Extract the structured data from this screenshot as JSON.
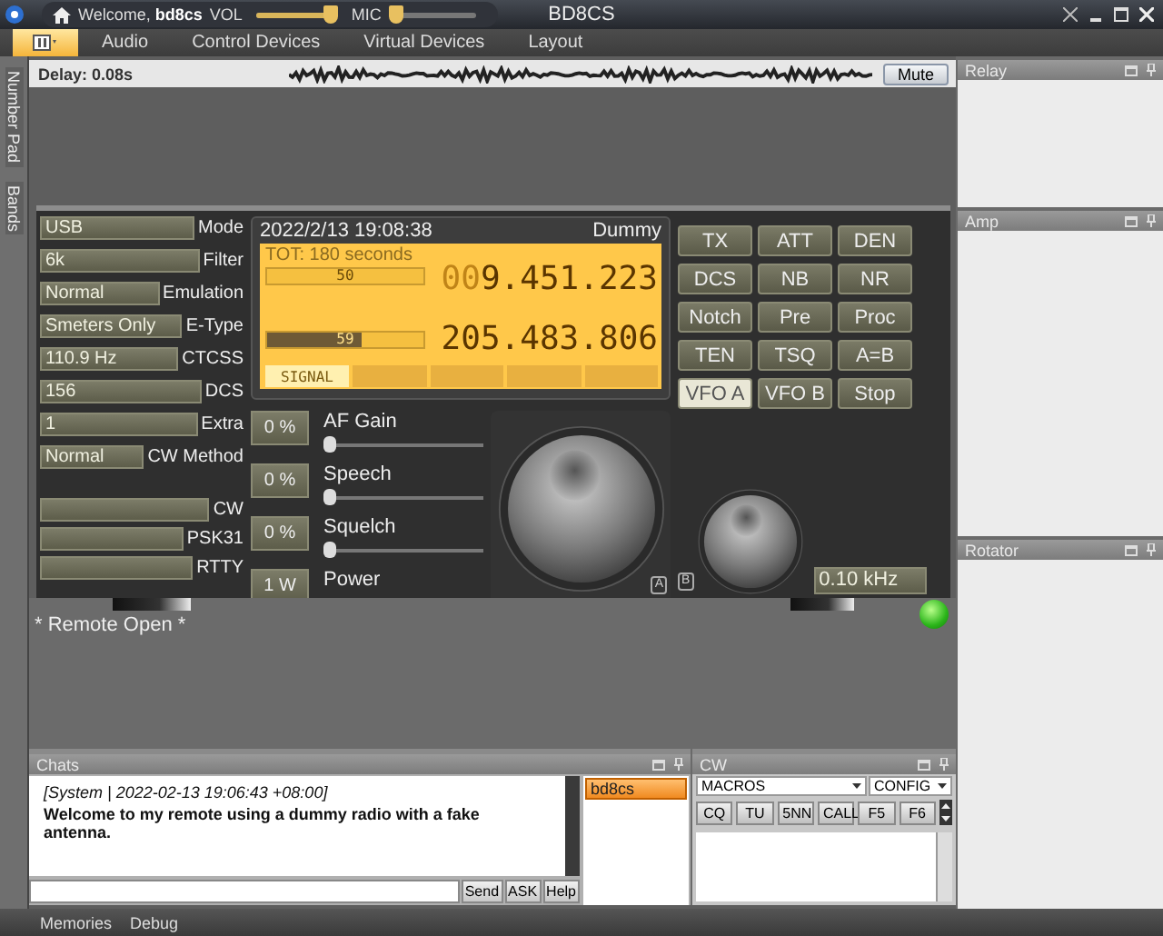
{
  "title_bar": {
    "welcome": "Welcome, **bd8cs**",
    "sliders": [
      {
        "label": "VOL",
        "level": 0.92
      },
      {
        "label": "MIC",
        "level": 0.0
      }
    ]
  },
  "window": {
    "title": "BD8CS"
  },
  "menu": [
    {
      "kind": "icon",
      "selected": true
    },
    {
      "kind": "text",
      "label": "Audio",
      "selected": false
    },
    {
      "kind": "text",
      "label": "Control Devices",
      "selected": false
    },
    {
      "kind": "text",
      "label": "Virtual Devices",
      "selected": false
    },
    {
      "kind": "text",
      "label": "Layout",
      "selected": false
    }
  ],
  "side_tabs": [
    "Number Pad",
    "Bands"
  ],
  "audio_bar": {
    "delay": "Delay: 0.08s",
    "mute": "Mute"
  },
  "radio": {
    "settings": [
      {
        "value": "USB",
        "label": "Mode"
      },
      {
        "value": "6k",
        "label": "Filter"
      },
      {
        "value": "Normal",
        "label": "Emulation"
      },
      {
        "value": "Smeters Only",
        "label": "E-Type"
      },
      {
        "value": "110.9 Hz",
        "label": "CTCSS"
      },
      {
        "value": "156",
        "label": "DCS"
      },
      {
        "value": "1",
        "label": "Extra"
      },
      {
        "value": "Normal",
        "label": "CW Method"
      }
    ],
    "modes": [
      {
        "label": "CW"
      },
      {
        "label": "PSK31"
      },
      {
        "label": "RTTY"
      }
    ],
    "display": {
      "datetime": "2022/2/13 19:08:38",
      "rig": "Dummy",
      "tot": "TOT: 180 seconds",
      "meters": [
        {
          "reading": "50",
          "level": 0.0
        },
        {
          "reading": "59",
          "level": 0.6
        }
      ],
      "frequencies": [
        {
          "prefix": "00",
          "value": "9.451.223"
        },
        {
          "value": "205.483.806"
        }
      ],
      "tabs": [
        {
          "label": "SIGNAL",
          "selected": true
        },
        {
          "selected": false
        },
        {
          "selected": false
        },
        {
          "selected": false
        },
        {
          "selected": false
        }
      ]
    },
    "controls": [
      {
        "reading": "0 %",
        "label": "AF Gain",
        "level": 0.0
      },
      {
        "reading": "0 %",
        "label": "Speech",
        "level": 0.0
      },
      {
        "reading": "0 %",
        "label": "Squelch",
        "level": 0.0
      },
      {
        "reading": "1 W",
        "label": "Power"
      }
    ],
    "main_knob_mark": "A",
    "buttons": [
      {
        "label": "TX",
        "selected": false
      },
      {
        "label": "ATT",
        "selected": false
      },
      {
        "label": "DEN",
        "selected": false
      },
      {
        "label": "DCS",
        "selected": false
      },
      {
        "label": "NB",
        "selected": false
      },
      {
        "label": "NR",
        "selected": false
      },
      {
        "label": "Notch",
        "selected": false
      },
      {
        "label": "Pre",
        "selected": false
      },
      {
        "label": "Proc",
        "selected": false
      },
      {
        "label": "TEN",
        "selected": false
      },
      {
        "label": "TSQ",
        "selected": false
      },
      {
        "label": "A=B",
        "selected": false
      },
      {
        "label": "VFO A",
        "selected": true
      },
      {
        "label": "VFO B",
        "selected": false
      },
      {
        "label": "Stop",
        "selected": false
      }
    ],
    "sub_knob_mark": "B",
    "step": "0.10 kHz"
  },
  "status": {
    "text": "* Remote Open *",
    "connected": true
  },
  "right_panels": [
    {
      "title": "Relay"
    },
    {
      "title": "Amp"
    },
    {
      "title": "Rotator"
    }
  ],
  "chats": {
    "title": "Chats",
    "messages": [
      {
        "header": "[System | 2022-02-13 19:06:43 +08:00]",
        "text": "Welcome to my remote using a dummy radio with a fake antenna."
      }
    ],
    "users": [
      {
        "name": "bd8cs",
        "selected": true
      }
    ],
    "buttons": [
      "Send",
      "ASK",
      "Help"
    ]
  },
  "cw": {
    "title": "CW",
    "dropdowns": [
      "MACROS",
      "CONFIG"
    ],
    "buttons": [
      "CQ",
      "TU",
      "5NN",
      "CALL",
      "F5",
      "F6"
    ]
  },
  "status_bar": [
    "Memories",
    "Debug"
  ]
}
